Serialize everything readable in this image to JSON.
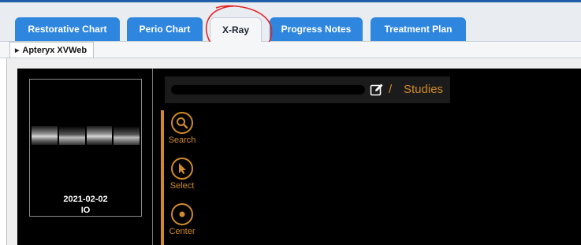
{
  "tabs": [
    {
      "label": "Restorative Chart"
    },
    {
      "label": "Perio Chart"
    },
    {
      "label": "X-Ray"
    },
    {
      "label": "Progress Notes"
    },
    {
      "label": "Treatment Plan"
    }
  ],
  "module": {
    "label": "Apteryx XVWeb"
  },
  "study_list": {
    "thumbnail": {
      "date": "2021-02-02",
      "modality": "IO"
    }
  },
  "header": {
    "breadcrumb_separator": "/",
    "breadcrumb_studies": "Studies"
  },
  "tools": [
    {
      "label": "Search",
      "icon": "search-icon"
    },
    {
      "label": "Select",
      "icon": "cursor-icon"
    },
    {
      "label": "Center",
      "icon": "center-icon"
    }
  ],
  "colors": {
    "tab_blue": "#2e86df",
    "accent_orange": "#d08a2b",
    "annotation_red": "#e0262b"
  }
}
